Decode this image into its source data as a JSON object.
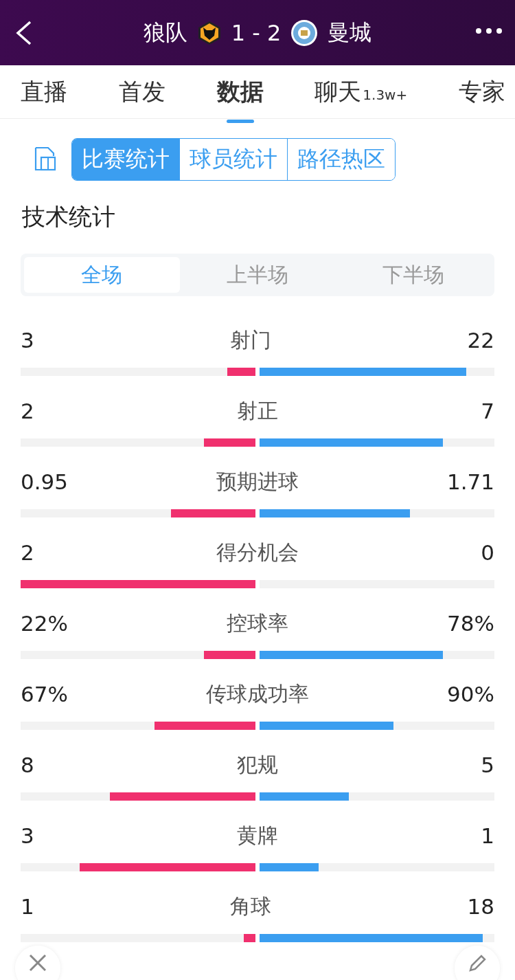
{
  "header": {
    "home": "狼队",
    "score": "1 - 2",
    "away": "曼城"
  },
  "tabs": [
    {
      "label": "直播",
      "selected": false
    },
    {
      "label": "首发",
      "selected": false
    },
    {
      "label": "数据",
      "selected": true
    },
    {
      "label": "聊天",
      "badge": "1.3w+",
      "selected": false
    },
    {
      "label": "专家",
      "selected": false
    }
  ],
  "segments": [
    {
      "label": "比赛统计",
      "selected": true
    },
    {
      "label": "球员统计",
      "selected": false
    },
    {
      "label": "路径热区",
      "selected": false
    }
  ],
  "section_title": "技术统计",
  "periods": [
    {
      "label": "全场",
      "selected": true
    },
    {
      "label": "上半场",
      "selected": false
    },
    {
      "label": "下半场",
      "selected": false
    }
  ],
  "stats": [
    {
      "name": "射门",
      "home": "3",
      "away": "22",
      "home_bar": {
        "level": 0.12
      },
      "away_bar": {
        "level": 0.88
      }
    },
    {
      "name": "射正",
      "home": "2",
      "away": "7",
      "home_bar": {
        "level": 0.22
      },
      "away_bar": {
        "level": 0.78
      }
    },
    {
      "name": "预期进球",
      "home": "0.95",
      "away": "1.71",
      "home_bar": {
        "level": 0.36
      },
      "away_bar": {
        "level": 0.64
      }
    },
    {
      "name": "得分机会",
      "home": "2",
      "away": "0",
      "home_bar": {
        "level": 1
      }
    },
    {
      "name": "控球率",
      "home": "22%",
      "away": "78%",
      "home_bar": {
        "level": 0.22
      },
      "away_bar": {
        "level": 0.78
      }
    },
    {
      "name": "传球成功率",
      "home": "67%",
      "away": "90%",
      "home_bar": {
        "level": 0.43
      },
      "away_bar": {
        "level": 0.57
      }
    },
    {
      "name": "犯规",
      "home": "8",
      "away": "5",
      "home_bar": {
        "level": 0.62
      },
      "away_bar": {
        "level": 0.38
      }
    },
    {
      "name": "黄牌",
      "home": "3",
      "away": "1",
      "home_bar": {
        "level": 0.75
      },
      "away_bar": {
        "level": 0.25
      }
    },
    {
      "name": "角球",
      "home": "1",
      "away": "18",
      "home_bar": {
        "level": 0.05
      },
      "away_bar": {
        "level": 0.95
      }
    }
  ]
}
